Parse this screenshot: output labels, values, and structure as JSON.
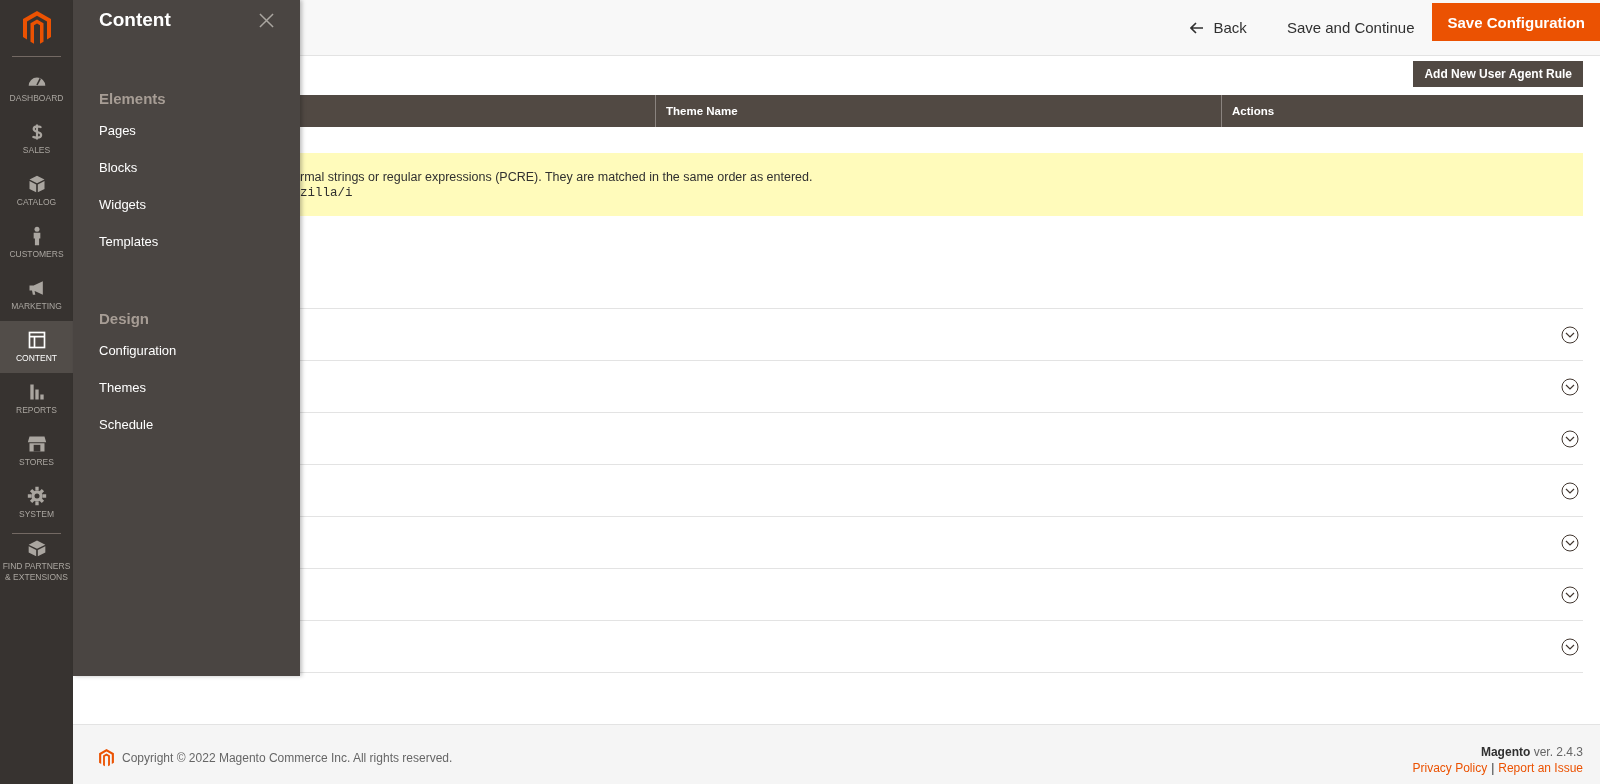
{
  "nav": [
    {
      "label": "DASHBOARD",
      "selected": false
    },
    {
      "label": "SALES",
      "selected": false
    },
    {
      "label": "CATALOG",
      "selected": false
    },
    {
      "label": "CUSTOMERS",
      "selected": false
    },
    {
      "label": "MARKETING",
      "selected": false
    },
    {
      "label": "CONTENT",
      "selected": true
    },
    {
      "label": "REPORTS",
      "selected": false
    },
    {
      "label": "STORES",
      "selected": false
    },
    {
      "label": "SYSTEM",
      "selected": false
    },
    {
      "label": "FIND PARTNERS & EXTENSIONS",
      "selected": false
    }
  ],
  "flyout": {
    "title": "Content",
    "sections": [
      {
        "heading": "Elements",
        "items": [
          "Pages",
          "Blocks",
          "Widgets",
          "Templates"
        ]
      },
      {
        "heading": "Design",
        "items": [
          "Configuration",
          "Themes",
          "Schedule"
        ]
      }
    ]
  },
  "header": {
    "back": "Back",
    "save_continue": "Save and Continue",
    "save_config": "Save Configuration"
  },
  "add_rule_button": "Add New User Agent Rule",
  "table": {
    "columns": [
      "Theme Name",
      "Actions"
    ]
  },
  "note": {
    "text": "rmal strings or regular expressions (PCRE). They are matched in the same order as entered.",
    "example": "zilla/i"
  },
  "sections": [
    {
      "expanded": false
    },
    {
      "expanded": false
    },
    {
      "expanded": false
    },
    {
      "expanded": false
    },
    {
      "expanded": false
    },
    {
      "expanded": false
    },
    {
      "expanded": false
    }
  ],
  "footer": {
    "copyright": "Copyright © 2022 Magento Commerce Inc. All rights reserved.",
    "brand": "Magento",
    "version": "ver. 2.4.3",
    "links": [
      "Privacy Policy",
      "Report an Issue"
    ],
    "separator": "|"
  }
}
